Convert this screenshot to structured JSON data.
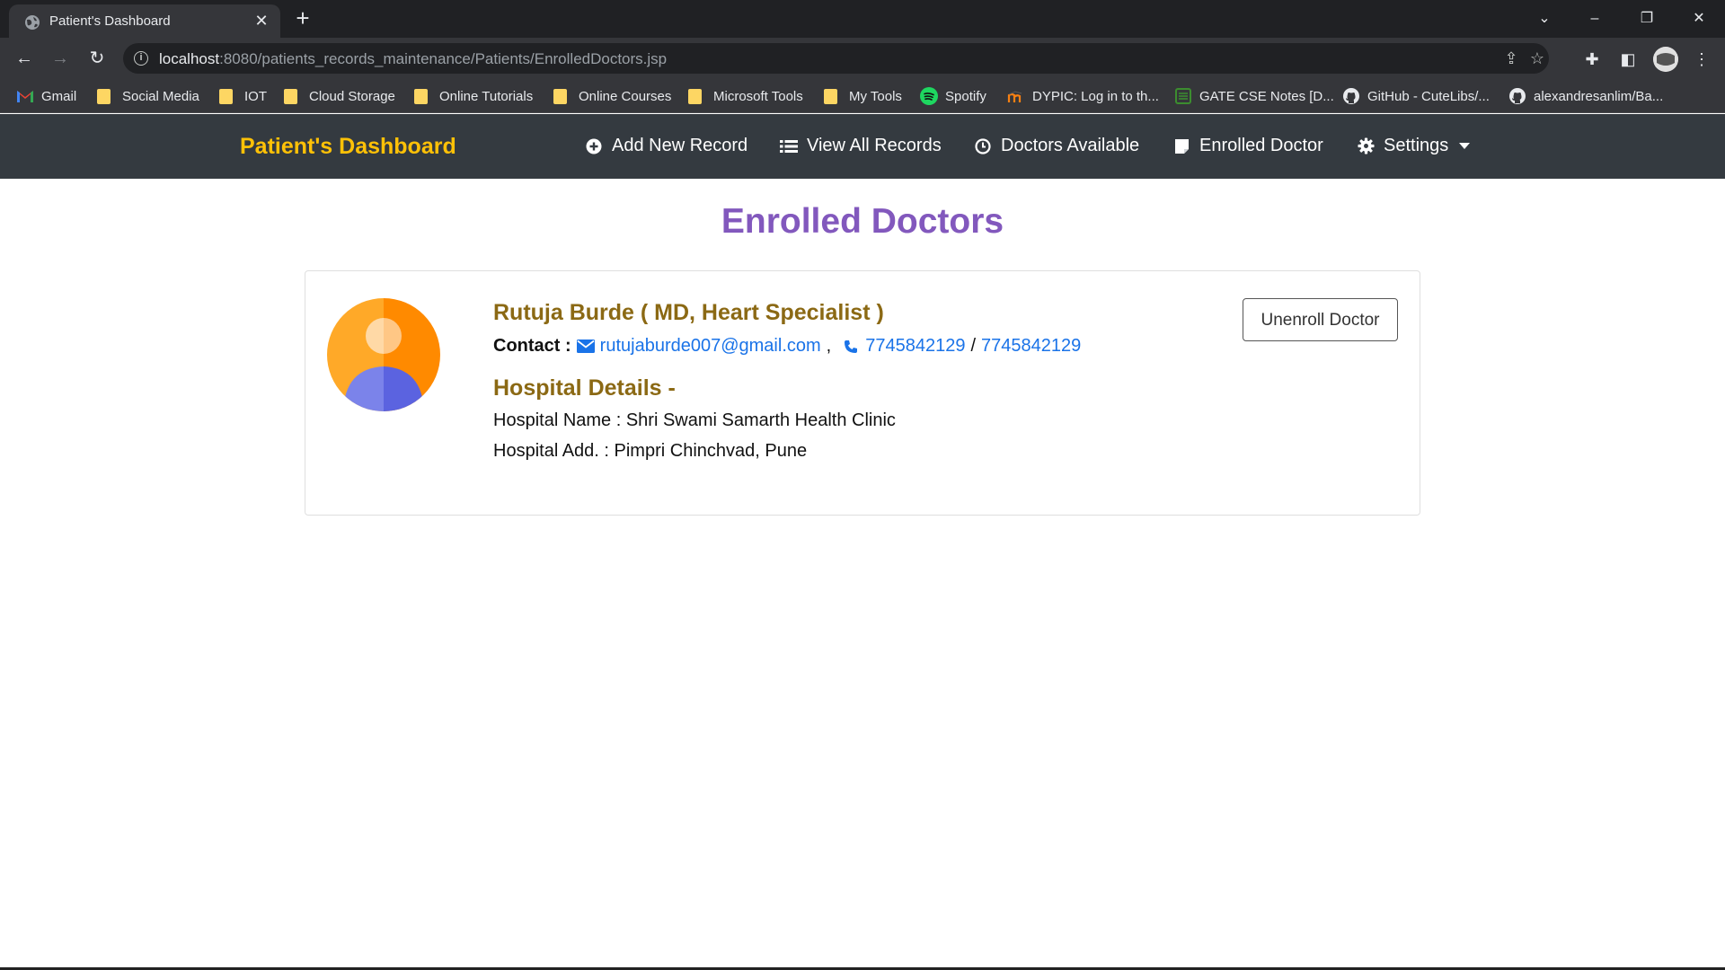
{
  "browser": {
    "tab_title": "Patient's Dashboard",
    "url_host": "localhost",
    "url_path": ":8080/patients_records_maintenance/Patients/EnrolledDoctors.jsp",
    "bookmarks": [
      {
        "label": "Gmail",
        "icon": "gmail-icon"
      },
      {
        "label": "Social Media",
        "icon": "folder-icon"
      },
      {
        "label": "IOT",
        "icon": "folder-icon"
      },
      {
        "label": "Cloud Storage",
        "icon": "folder-icon"
      },
      {
        "label": "Online Tutorials",
        "icon": "folder-icon"
      },
      {
        "label": "Online Courses",
        "icon": "folder-icon"
      },
      {
        "label": "Microsoft Tools",
        "icon": "folder-icon"
      },
      {
        "label": "My Tools",
        "icon": "folder-icon"
      },
      {
        "label": "Spotify",
        "icon": "spotify-icon"
      },
      {
        "label": "DYPIC: Log in to th...",
        "icon": "moodle-icon"
      },
      {
        "label": "GATE CSE Notes [D...",
        "icon": "notes-icon"
      },
      {
        "label": "GitHub - CuteLibs/...",
        "icon": "github-icon"
      },
      {
        "label": "alexandresanlim/Ba...",
        "icon": "github-icon"
      }
    ]
  },
  "navbar": {
    "brand": "Patient's Dashboard",
    "items": [
      {
        "label": "Add New Record",
        "icon": "plus-circle-icon"
      },
      {
        "label": "View All Records",
        "icon": "list-icon"
      },
      {
        "label": "Doctors Available",
        "icon": "clock-icon"
      },
      {
        "label": "Enrolled Doctor",
        "icon": "sticky-note-icon"
      },
      {
        "label": "Settings",
        "icon": "gear-icon"
      }
    ]
  },
  "page": {
    "heading": "Enrolled Doctors"
  },
  "doctor": {
    "name": "Rutuja Burde ( MD, Heart Specialist )",
    "contact_label": "Contact :",
    "email": "rutujaburde007@gmail.com",
    "separator": ",",
    "phone1": "7745842129",
    "phone_sep": "/",
    "phone2": "7745842129",
    "hospital_heading": "Hospital Details -",
    "hospital_name": "Hospital Name : Shri Swami Samarth Health Clinic",
    "hospital_address": "Hospital Add. : Pimpri Chinchvad, Pune",
    "unenroll_label": "Unenroll Doctor"
  },
  "colors": {
    "brand": "#ffc107",
    "heading": "#8258bd",
    "doctor_text": "#8b6914",
    "link": "#1a73e8",
    "navbar_bg": "#343a40"
  }
}
